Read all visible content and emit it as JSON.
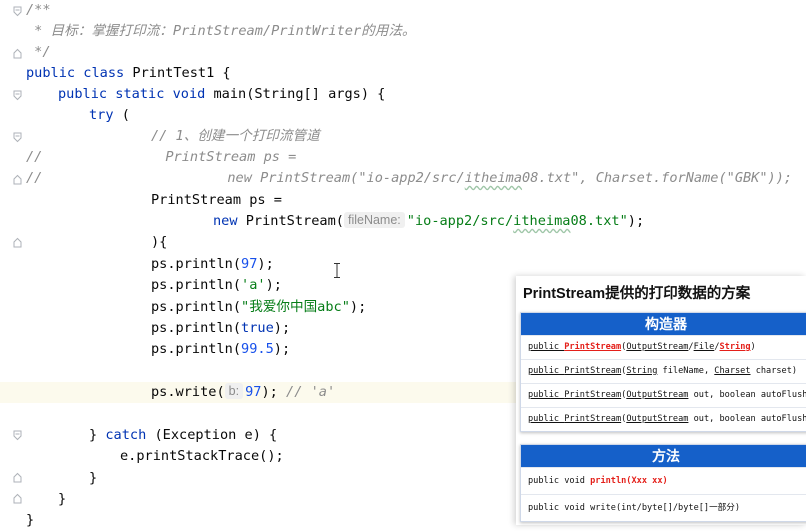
{
  "editor": {
    "comment_open": "/**",
    "comment_line": " * 目标：掌握打印流：PrintStream/PrintWriter的用法。",
    "comment_close": " */",
    "class_kw": "public class ",
    "class_name": "PrintTest1 {",
    "main_kw": "public static void ",
    "main_sig": "main(String[] args) {",
    "try_kw": "try",
    "try_paren": " (",
    "comment_create": "// 1、创建一个打印流管道",
    "line_comment_marker": "//",
    "commented_decl": "PrintStream ps =",
    "commented_new_kw": "new ",
    "commented_new_a": "PrintStream(\"io-app2/src/",
    "commented_new_sq": "itheima",
    "commented_new_b": "08.txt\", Charset.forName(\"GBK\"));",
    "decl": "PrintStream ps =",
    "new_kw": "new ",
    "new_call": "PrintStream(",
    "param_hint": "fileName:",
    "file_str_a": "\"io-app2/src/",
    "file_str_sq": "itheima",
    "file_str_b": "08.txt\"",
    "new_close": ");",
    "try_close": "){",
    "println_prefix": "ps.println(",
    "p1_arg": "97",
    "p2_arg": "'a'",
    "p3_arg": "\"我爱你中国abc\"",
    "p4_arg": "true",
    "p5_arg": "99.5",
    "stmt_close": ");",
    "write_prefix": "ps.write(",
    "write_hint": "b:",
    "write_arg": "97",
    "write_close": ");",
    "write_comment": "// 'a'",
    "catch_open": "} ",
    "catch_kw": "catch",
    "catch_rest": " (Exception e) {",
    "stacktrace": "e.printStackTrace();",
    "brace": "}"
  },
  "slide": {
    "title": "PrintStream提供的打印数据的方案",
    "constructors_header": "构造器",
    "c1_kw": "public ",
    "c1_name": "PrintStream",
    "c1_a": "(",
    "c1_b": "OutputStream",
    "c1_c": "/",
    "c1_d": "File",
    "c1_e": "/",
    "c1_f": "String",
    "c1_g": ")",
    "c2_kw": "public ",
    "c2_name": "PrintStream",
    "c2_a": "(",
    "c2_b": "String",
    "c2_c": " fileName, ",
    "c2_d": "Charset",
    "c2_e": " charset)",
    "c3_kw": "public ",
    "c3_name": "PrintStream",
    "c3_a": "(",
    "c3_b": "OutputStream",
    "c3_c": " out, boolean autoFlush)",
    "c4_kw": "public ",
    "c4_name": "PrintStream",
    "c4_a": "(",
    "c4_b": "OutputStream",
    "c4_c": " out, boolean autoFlush",
    "methods_header": "方法",
    "m1_a": "public void ",
    "m1_b": "println(Xxx xx)",
    "m2": "public void write(int/byte[]/byte[]一部分)"
  },
  "colors": {
    "keyword": "#0033b3",
    "string": "#067d17",
    "number": "#1750eb",
    "comment": "#8c8c8c",
    "header_blue": "#1560c9",
    "highlight_red": "#e4201a"
  }
}
